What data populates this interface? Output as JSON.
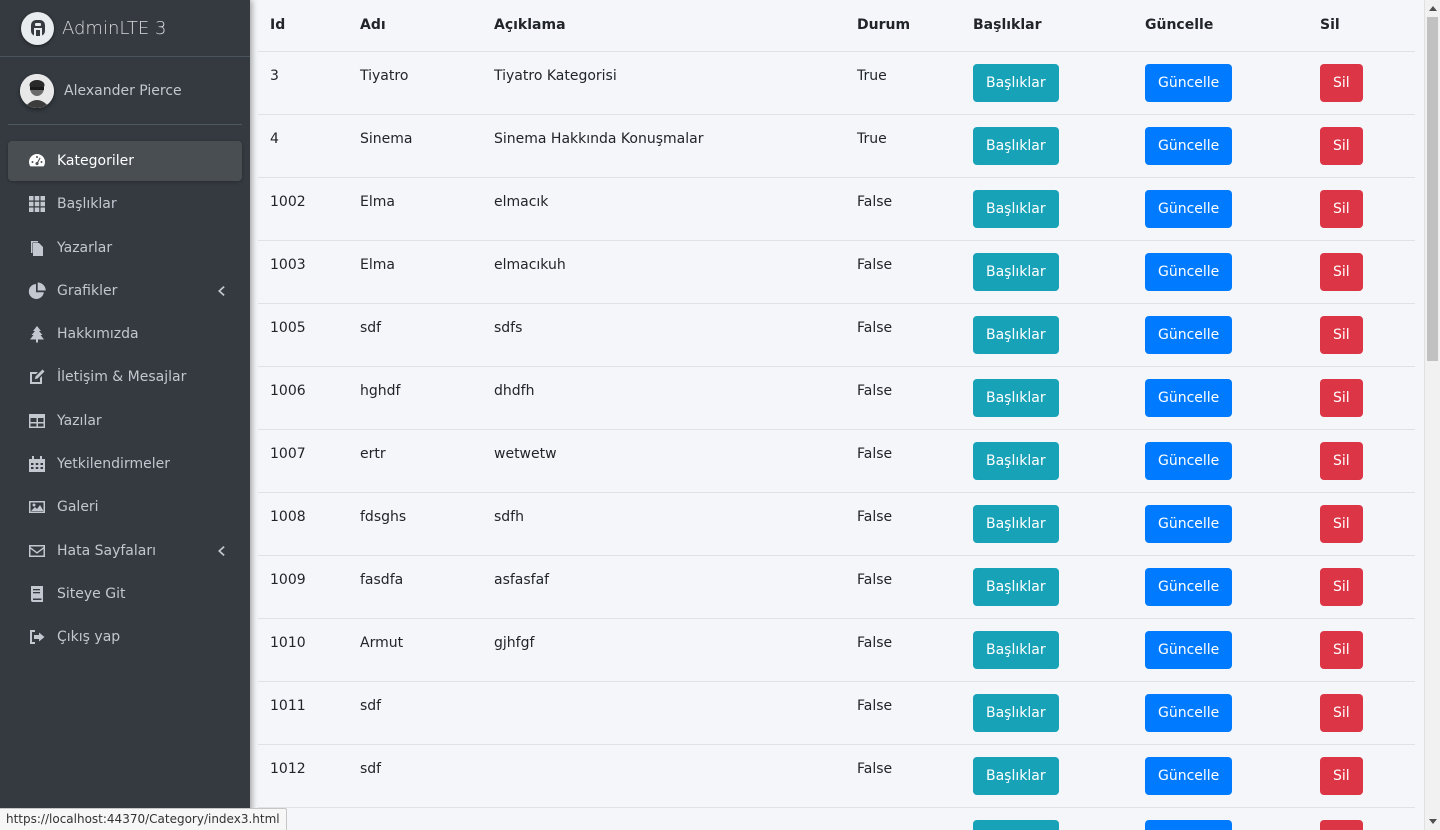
{
  "brand": {
    "name": "AdminLTE 3"
  },
  "user": {
    "name": "Alexander Pierce"
  },
  "sidebar": {
    "items": [
      {
        "label": "Kategoriler",
        "icon": "tachometer-icon",
        "active": true
      },
      {
        "label": "Başlıklar",
        "icon": "grid-icon"
      },
      {
        "label": "Yazarlar",
        "icon": "copy-icon"
      },
      {
        "label": "Grafikler",
        "icon": "pie-chart-icon",
        "chevron": true
      },
      {
        "label": "Hakkımızda",
        "icon": "tree-icon"
      },
      {
        "label": "İletişim & Mesajlar",
        "icon": "edit-icon"
      },
      {
        "label": "Yazılar",
        "icon": "table-icon"
      },
      {
        "label": "Yetkilendirmeler",
        "icon": "calendar-icon"
      },
      {
        "label": "Galeri",
        "icon": "image-icon"
      },
      {
        "label": "Hata Sayfaları",
        "icon": "envelope-icon",
        "chevron": true
      },
      {
        "label": "Siteye Git",
        "icon": "book-icon"
      },
      {
        "label": "Çıkış yap",
        "icon": "sign-out-icon"
      }
    ]
  },
  "table": {
    "headers": [
      "Id",
      "Adı",
      "Açıklama",
      "Durum",
      "Başlıklar",
      "Güncelle",
      "Sil"
    ],
    "button_labels": {
      "basliklar": "Başlıklar",
      "guncelle": "Güncelle",
      "sil": "Sil"
    },
    "rows": [
      {
        "id": "3",
        "adi": "Tiyatro",
        "aciklama": "Tiyatro Kategorisi",
        "durum": "True"
      },
      {
        "id": "4",
        "adi": "Sinema",
        "aciklama": "Sinema Hakkında Konuşmalar",
        "durum": "True"
      },
      {
        "id": "1002",
        "adi": "Elma",
        "aciklama": "elmacık",
        "durum": "False"
      },
      {
        "id": "1003",
        "adi": "Elma",
        "aciklama": "elmacıkuh",
        "durum": "False"
      },
      {
        "id": "1005",
        "adi": "sdf",
        "aciklama": "sdfs",
        "durum": "False"
      },
      {
        "id": "1006",
        "adi": "hghdf",
        "aciklama": "dhdfh",
        "durum": "False"
      },
      {
        "id": "1007",
        "adi": "ertr",
        "aciklama": "wetwetw",
        "durum": "False"
      },
      {
        "id": "1008",
        "adi": "fdsghs",
        "aciklama": "sdfh",
        "durum": "False"
      },
      {
        "id": "1009",
        "adi": "fasdfa",
        "aciklama": "asfasfaf",
        "durum": "False"
      },
      {
        "id": "1010",
        "adi": "Armut",
        "aciklama": "gjhfgf",
        "durum": "False"
      },
      {
        "id": "1011",
        "adi": "sdf",
        "aciklama": "",
        "durum": "False"
      },
      {
        "id": "1012",
        "adi": "sdf",
        "aciklama": "",
        "durum": "False"
      },
      {
        "id": "",
        "adi": "",
        "aciklama": "",
        "durum": ""
      }
    ]
  },
  "status_bar": {
    "url": "https://localhost:44370/Category/index3.html"
  },
  "colors": {
    "sidebar_bg": "#343a40",
    "info": "#17a2b8",
    "primary": "#007bff",
    "danger": "#dc3545"
  }
}
